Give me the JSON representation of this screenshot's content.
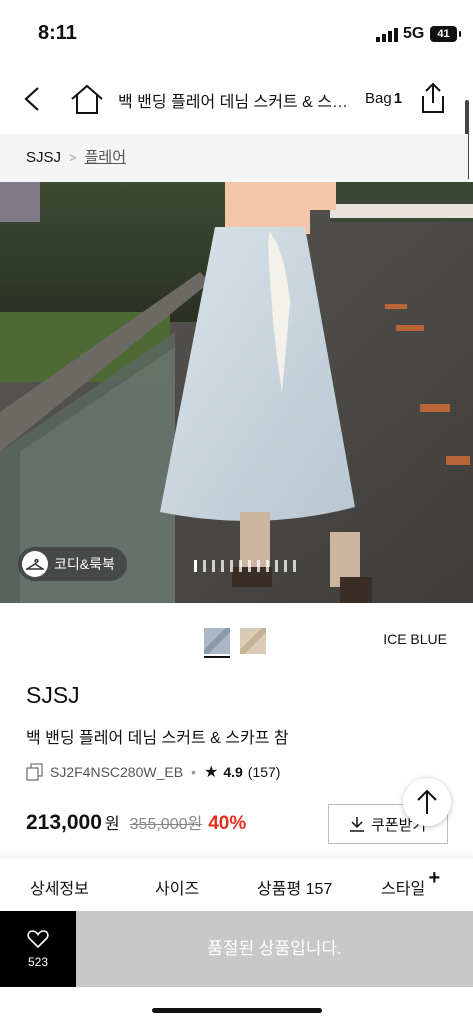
{
  "status_bar": {
    "time": "8:11",
    "network": "5G",
    "battery": "41"
  },
  "nav": {
    "title": "백 밴딩 플레어 데님 스커트 & 스카프 참",
    "bag_label": "Bag",
    "bag_count": "1"
  },
  "breadcrumb": {
    "brand": "SJSJ",
    "category": "플레어"
  },
  "hero": {
    "coordi_label": "코디&룩북"
  },
  "color": {
    "name": "ICE BLUE",
    "accent": "#e0301e"
  },
  "product": {
    "brand": "SJSJ",
    "name": "백 밴딩 플레어 데님 스커트 & 스카프 참",
    "code": "SJ2F4NSC280W_EB",
    "rating": "4.9",
    "review_count": "(157)",
    "price": "213,000",
    "currency": "원",
    "original_price": "355,000원",
    "discount": "40%",
    "coupon_label": "쿠폰받기"
  },
  "tabs": [
    {
      "label": "상세정보"
    },
    {
      "label": "사이즈"
    },
    {
      "label": "상품평 157"
    },
    {
      "label": "스타일"
    }
  ],
  "bottom": {
    "like_count": "523",
    "soldout_label": "품절된 상품입니다."
  }
}
